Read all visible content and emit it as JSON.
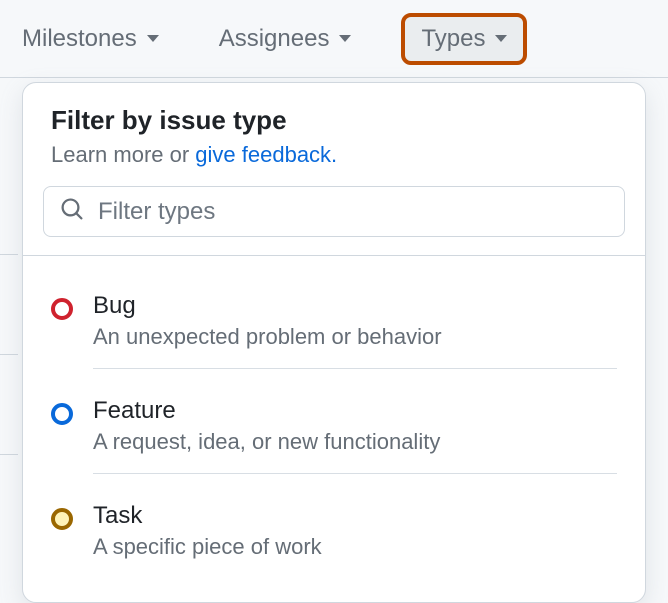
{
  "filterBar": {
    "milestones": "Milestones",
    "assignees": "Assignees",
    "types": "Types"
  },
  "dropdown": {
    "title": "Filter by issue type",
    "subtitlePrefix": "Learn more or ",
    "subtitleLink": "give feedback.",
    "searchPlaceholder": "Filter types",
    "items": [
      {
        "name": "Bug",
        "desc": "An unexpected problem or behavior",
        "color": "red"
      },
      {
        "name": "Feature",
        "desc": "A request, idea, or new functionality",
        "color": "blue"
      },
      {
        "name": "Task",
        "desc": "A specific piece of work",
        "color": "yellow"
      }
    ]
  }
}
